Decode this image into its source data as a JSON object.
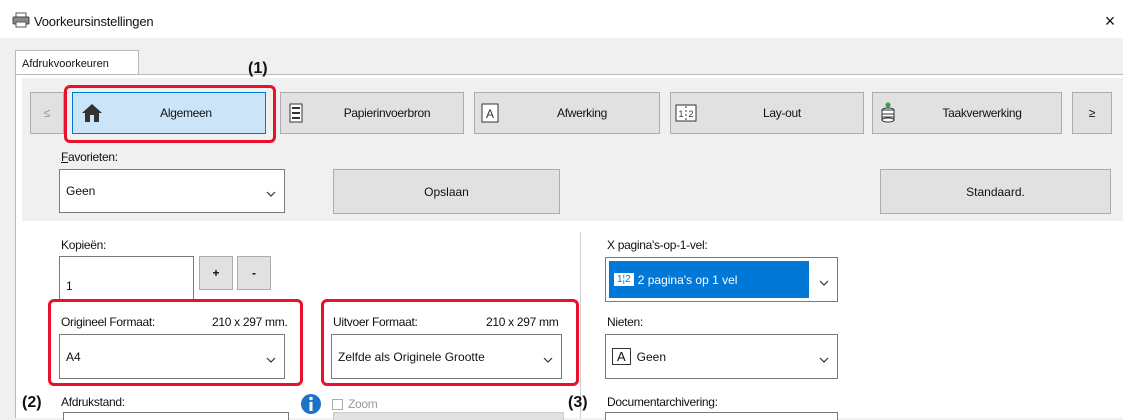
{
  "window": {
    "title": "Voorkeursinstellingen",
    "close": "×"
  },
  "tab": {
    "label": "Afdrukvoorkeuren"
  },
  "nav": {
    "prev": "≤",
    "next": "≥",
    "buttons": [
      {
        "label": "Algemeen",
        "icon": "home-icon"
      },
      {
        "label": "Papierinvoerbron",
        "icon": "paper-tray-icon"
      },
      {
        "label": "Afwerking",
        "icon": "finishing-icon"
      },
      {
        "label": "Lay-out",
        "icon": "layout-icon"
      },
      {
        "label": "Taakverwerking",
        "icon": "job-handling-icon"
      }
    ]
  },
  "favorites": {
    "label": "Favorieten:",
    "value": "Geen",
    "save": "Opslaan",
    "default": "Standaard."
  },
  "copies": {
    "label": "Kopieën:",
    "value": "1",
    "plus": "+",
    "minus": "-"
  },
  "nup": {
    "label": "X pagina's-op-1-vel:",
    "value": "2 pagina's op 1 vel",
    "icon_text": "1¦2"
  },
  "original_size": {
    "label": "Origineel Formaat:",
    "dims": "210 x 297 mm.",
    "value": "A4"
  },
  "output_size": {
    "label": "Uitvoer Formaat:",
    "dims": "210 x 297 mm",
    "value": "Zelfde als Originele Grootte"
  },
  "staple": {
    "label": "Nieten:",
    "value": "Geen",
    "icon_text": "A"
  },
  "orientation": {
    "label": "Afdrukstand:"
  },
  "zoom": {
    "label": "Zoom"
  },
  "docfiling": {
    "label": "Documentarchivering:"
  },
  "annotations": {
    "a1": "(1)",
    "a2": "(2)",
    "a3": "(3)"
  },
  "colors": {
    "red": "#e8112d",
    "blue": "#0078d7",
    "selected": "#cce4f7"
  }
}
